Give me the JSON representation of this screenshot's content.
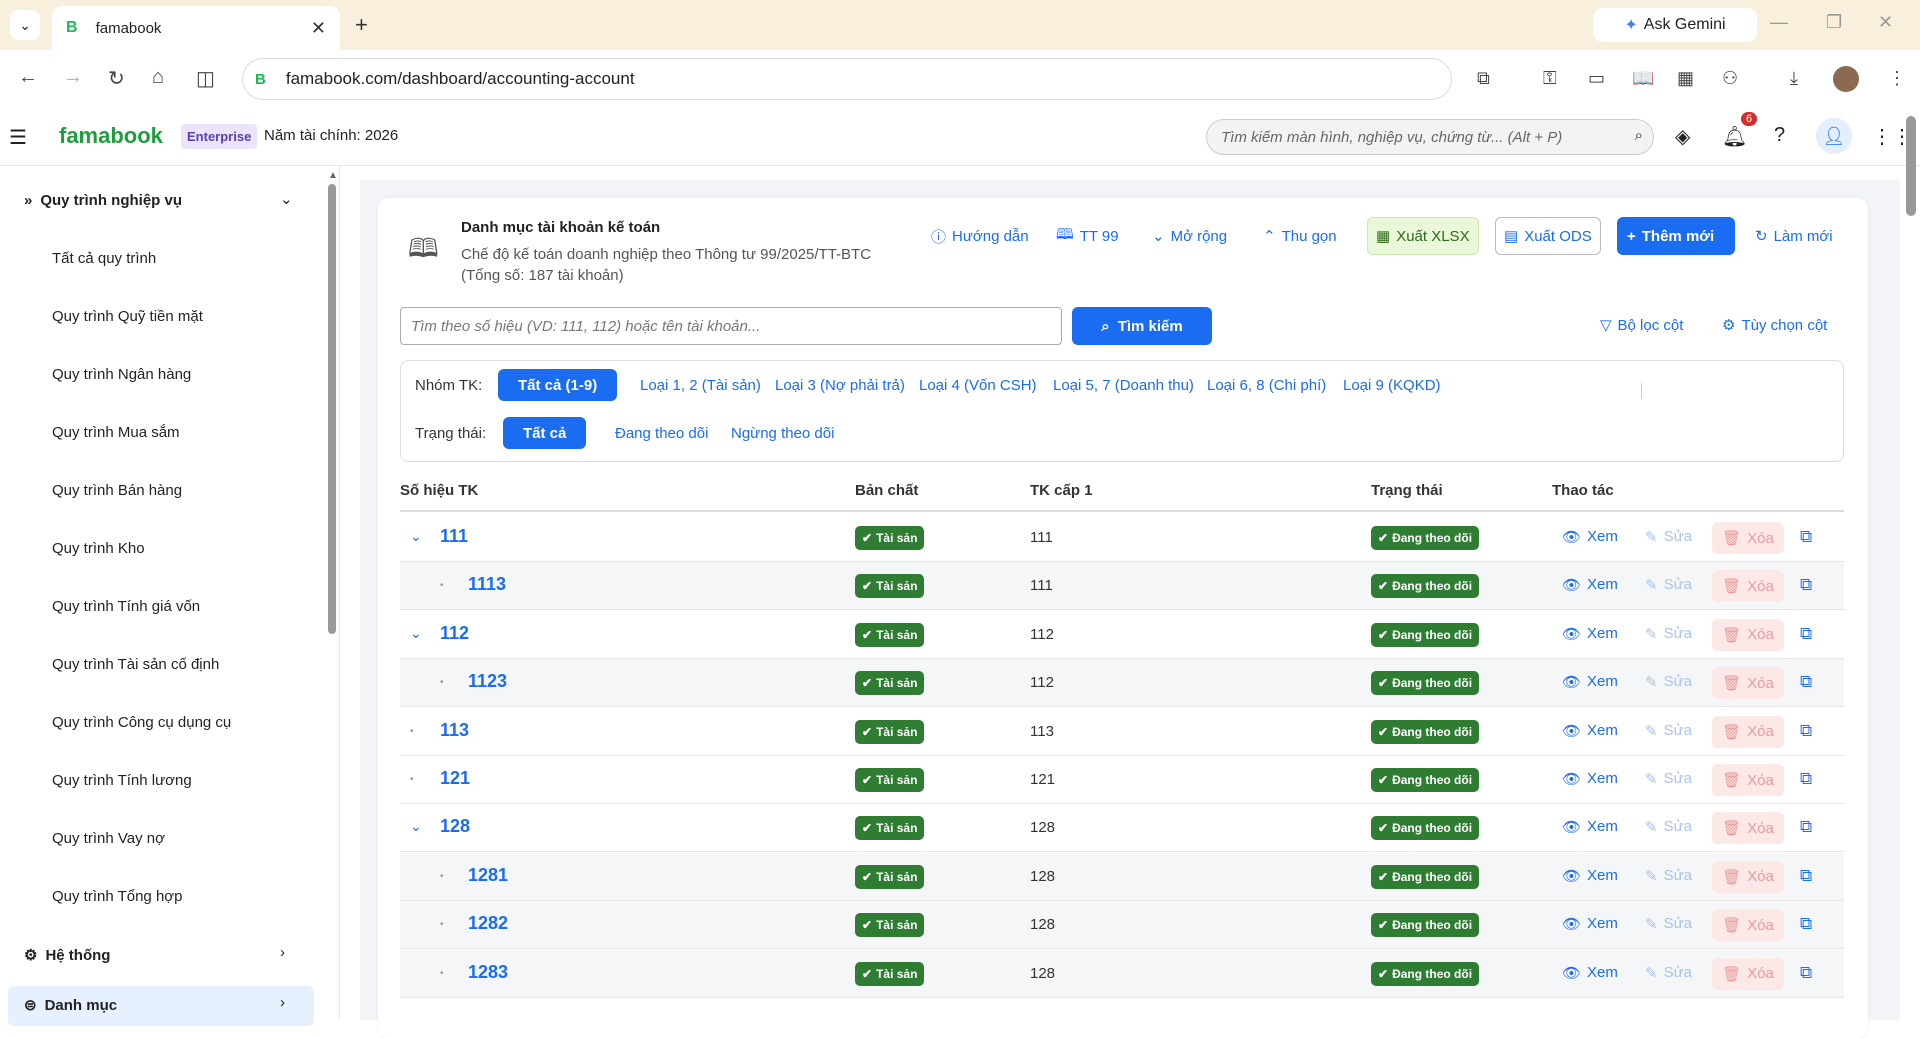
{
  "browser": {
    "tab_title": "famabook",
    "gemini_label": "Ask Gemini",
    "url": "famabook.com/dashboard/accounting-account"
  },
  "header": {
    "brand": "famabook",
    "edition": "Enterprise",
    "fiscal_year": "Năm tài chính: 2026",
    "search_placeholder": "Tìm kiếm màn hình, nghiệp vụ, chứng từ... (Alt + P)",
    "notification_count": "6"
  },
  "sidebar": {
    "section": "Quy trình nghiệp vụ",
    "items": [
      "Tất cả quy trình",
      "Quy trình Quỹ tiền mặt",
      "Quy trình Ngân hàng",
      "Quy trình Mua sắm",
      "Quy trình Bán hàng",
      "Quy trình Kho",
      "Quy trình Tính giá vốn",
      "Quy trình Tài sản cố định",
      "Quy trình Công cụ dụng cụ",
      "Quy trình Tính lương",
      "Quy trình Vay nợ",
      "Quy trình Tổng hợp"
    ],
    "system": "Hệ thống",
    "catalog": "Danh mục"
  },
  "page": {
    "title": "Danh mục tài khoản kế toán",
    "subtitle": "Chế độ kế toán doanh nghiệp theo Thông tư 99/2025/TT-BTC (Tổng số: 187 tài khoản)",
    "toolbar": {
      "guide": "Hướng dẫn",
      "tt99": "TT 99",
      "expand": "Mở rộng",
      "collapse": "Thu gọn",
      "export_xlsx": "Xuất XLSX",
      "export_ods": "Xuất ODS",
      "add_new": "Thêm mới",
      "refresh": "Làm mới"
    },
    "search_placeholder": "Tìm theo số hiệu (VD: 111, 112) hoặc tên tài khoản...",
    "search_button": "Tìm kiếm",
    "column_filter": "Bộ lọc cột",
    "column_options": "Tùy chọn cột",
    "group_label": "Nhóm TK:",
    "groups": [
      "Tất cả (1-9)",
      "Loại 1, 2 (Tài sản)",
      "Loại 3 (Nợ phải trả)",
      "Loại 4 (Vốn CSH)",
      "Loại 5, 7 (Doanh thu)",
      "Loại 6, 8 (Chi phí)",
      "Loại 9 (KQKD)"
    ],
    "status_label": "Trạng thái:",
    "statuses": [
      "Tất cả",
      "Đang theo dõi",
      "Ngừng theo dõi"
    ]
  },
  "table": {
    "columns": [
      "Số hiệu TK",
      "Bản chất",
      "TK cấp 1",
      "Trạng thái",
      "Thao tác"
    ],
    "actions": {
      "view": "Xem",
      "edit": "Sửa",
      "delete": "Xóa"
    },
    "rows": [
      {
        "code": "111",
        "nature": "Tài sản",
        "parent": "111",
        "status": "Đang theo dõi"
      },
      {
        "code": "1113",
        "nature": "Tài sản",
        "parent": "111",
        "status": "Đang theo dõi"
      },
      {
        "code": "112",
        "nature": "Tài sản",
        "parent": "112",
        "status": "Đang theo dõi"
      },
      {
        "code": "1123",
        "nature": "Tài sản",
        "parent": "112",
        "status": "Đang theo dõi"
      },
      {
        "code": "113",
        "nature": "Tài sản",
        "parent": "113",
        "status": "Đang theo dõi"
      },
      {
        "code": "121",
        "nature": "Tài sản",
        "parent": "121",
        "status": "Đang theo dõi"
      },
      {
        "code": "128",
        "nature": "Tài sản",
        "parent": "128",
        "status": "Đang theo dõi"
      },
      {
        "code": "1281",
        "nature": "Tài sản",
        "parent": "128",
        "status": "Đang theo dõi"
      },
      {
        "code": "1282",
        "nature": "Tài sản",
        "parent": "128",
        "status": "Đang theo dõi"
      },
      {
        "code": "1283",
        "nature": "Tài sản",
        "parent": "128",
        "status": "Đang theo dõi"
      }
    ]
  }
}
